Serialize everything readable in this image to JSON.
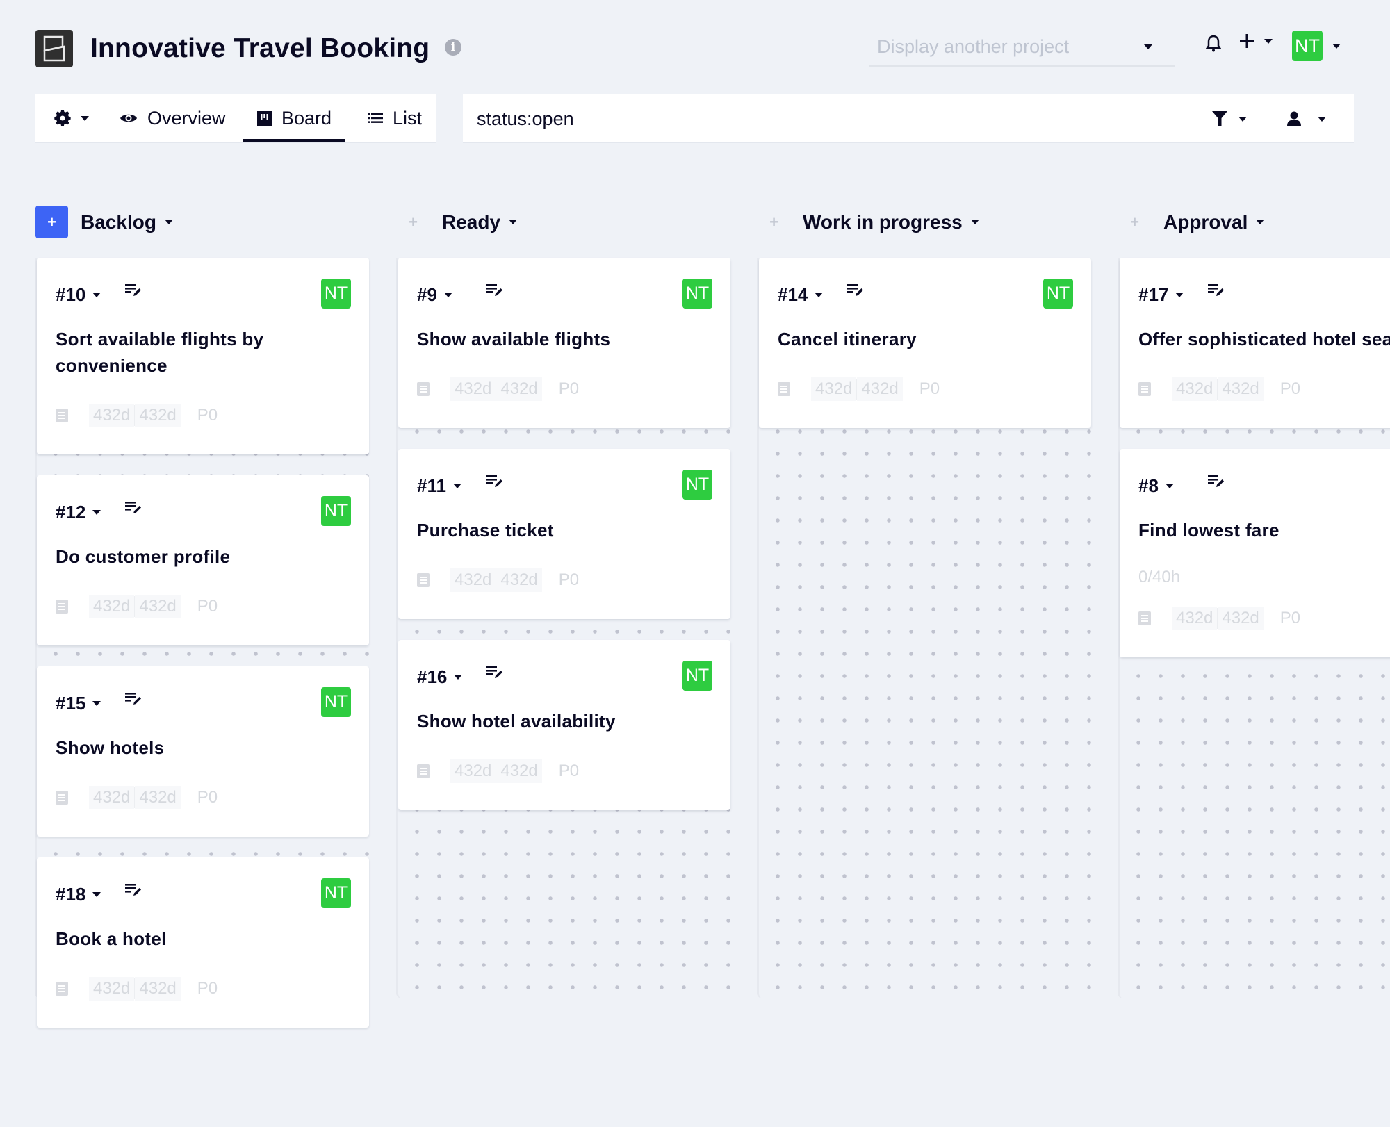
{
  "header": {
    "title": "Innovative Travel Booking",
    "info_icon": "info-icon",
    "project_select_placeholder": "Display another project",
    "user_initials": "NT",
    "avatar_color": "#2ecc40"
  },
  "toolbar": {
    "settings_icon": "gear-icon",
    "tabs": [
      {
        "label": "Overview",
        "icon": "eye-icon",
        "active": false
      },
      {
        "label": "Board",
        "icon": "board-icon",
        "active": true
      },
      {
        "label": "List",
        "icon": "list-icon",
        "active": false
      }
    ],
    "search_query": "status:open",
    "filter_icon": "filter-icon",
    "user_filter_icon": "user-icon"
  },
  "columns": [
    {
      "name": "Backlog",
      "add_label": "+",
      "cards": [
        {
          "id": "#10",
          "title": "Sort available flights by convenience",
          "assignee": "NT",
          "age1": "432d",
          "age2": "432d",
          "priority": "P0"
        },
        {
          "id": "#12",
          "title": "Do customer profile",
          "assignee": "NT",
          "age1": "432d",
          "age2": "432d",
          "priority": "P0"
        },
        {
          "id": "#15",
          "title": "Show hotels",
          "assignee": "NT",
          "age1": "432d",
          "age2": "432d",
          "priority": "P0"
        },
        {
          "id": "#18",
          "title": "Book a hotel",
          "assignee": "NT",
          "age1": "432d",
          "age2": "432d",
          "priority": "P0"
        }
      ]
    },
    {
      "name": "Ready",
      "add_label": "+",
      "cards": [
        {
          "id": "#9",
          "title": "Show available flights",
          "assignee": "NT",
          "age1": "432d",
          "age2": "432d",
          "priority": "P0"
        },
        {
          "id": "#11",
          "title": "Purchase ticket",
          "assignee": "NT",
          "age1": "432d",
          "age2": "432d",
          "priority": "P0"
        },
        {
          "id": "#16",
          "title": "Show hotel availability",
          "assignee": "NT",
          "age1": "432d",
          "age2": "432d",
          "priority": "P0"
        }
      ]
    },
    {
      "name": "Work in progress",
      "add_label": "+",
      "cards": [
        {
          "id": "#14",
          "title": "Cancel itinerary",
          "assignee": "NT",
          "age1": "432d",
          "age2": "432d",
          "priority": "P0"
        }
      ]
    },
    {
      "name": "Approval",
      "add_label": "+",
      "cards": [
        {
          "id": "#17",
          "title": "Offer sophisticated hotel search",
          "assignee": "",
          "age1": "432d",
          "age2": "432d",
          "priority": "P0"
        },
        {
          "id": "#8",
          "title": "Find lowest fare",
          "assignee": "",
          "estimate": "0/40h",
          "age1": "432d",
          "age2": "432d",
          "priority": "P0"
        }
      ]
    }
  ]
}
